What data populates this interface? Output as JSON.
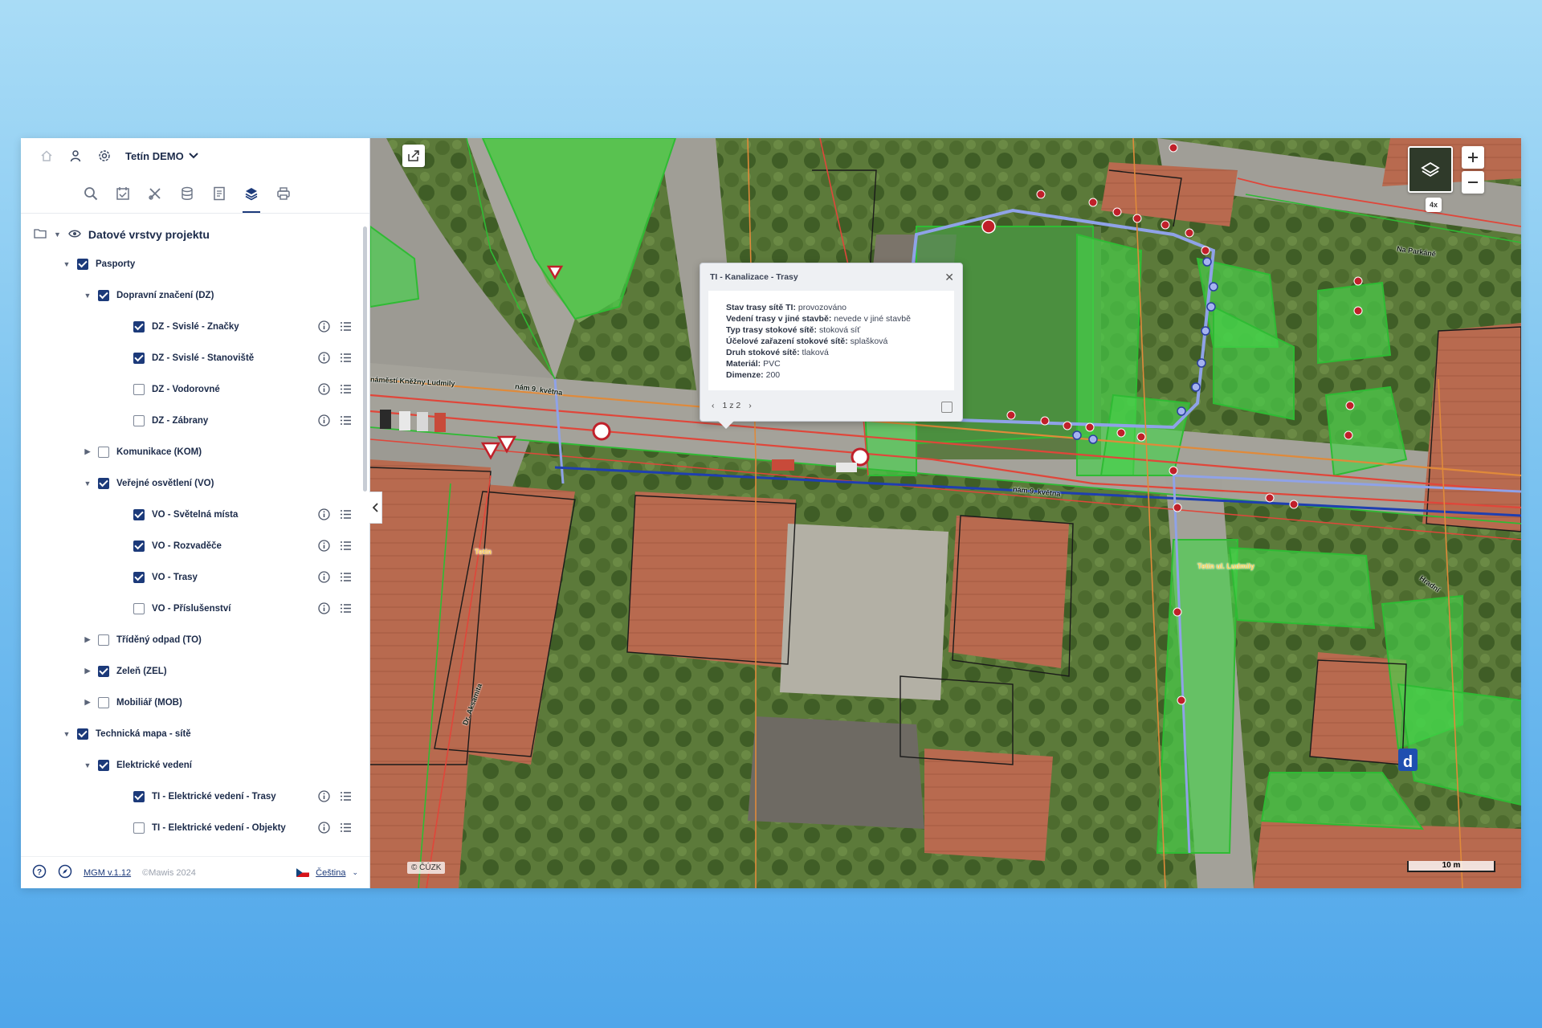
{
  "header": {
    "project_name": "Tetín DEMO",
    "home_icon": "home-icon",
    "user_icon": "user-icon",
    "project_icon": "settings-icon"
  },
  "toolbar": {
    "tools": [
      "search-icon",
      "measure-icon",
      "edit-tools-icon",
      "database-icon",
      "bookmark-icon",
      "layers-icon",
      "print-icon"
    ],
    "active": "layers-icon"
  },
  "tree": {
    "root_label": "Datové vrstvy projektu",
    "items": [
      {
        "label": "Pasporty",
        "level": 0,
        "expanded": true,
        "checked": true,
        "twisty": true,
        "actions": false
      },
      {
        "label": "Dopravní značení (DZ)",
        "level": 1,
        "expanded": true,
        "checked": true,
        "twisty": true,
        "actions": false
      },
      {
        "label": "DZ - Svislé - Značky",
        "level": 2,
        "checked": true,
        "twisty": false,
        "actions": true
      },
      {
        "label": "DZ - Svislé - Stanoviště",
        "level": 2,
        "checked": true,
        "twisty": false,
        "actions": true
      },
      {
        "label": "DZ - Vodorovné",
        "level": 2,
        "checked": false,
        "twisty": false,
        "actions": true
      },
      {
        "label": "DZ - Zábrany",
        "level": 2,
        "checked": false,
        "twisty": false,
        "actions": true
      },
      {
        "label": "Komunikace (KOM)",
        "level": 1,
        "expanded": false,
        "checked": false,
        "twisty": true,
        "actions": false
      },
      {
        "label": "Veřejné osvětlení (VO)",
        "level": 1,
        "expanded": true,
        "checked": true,
        "twisty": true,
        "actions": false
      },
      {
        "label": "VO - Světelná místa",
        "level": 2,
        "checked": true,
        "twisty": false,
        "actions": true
      },
      {
        "label": "VO - Rozvaděče",
        "level": 2,
        "checked": true,
        "twisty": false,
        "actions": true
      },
      {
        "label": "VO - Trasy",
        "level": 2,
        "checked": true,
        "twisty": false,
        "actions": true
      },
      {
        "label": "VO - Příslušenství",
        "level": 2,
        "checked": false,
        "twisty": false,
        "actions": true
      },
      {
        "label": "Tříděný odpad (TO)",
        "level": 1,
        "expanded": false,
        "checked": false,
        "twisty": true,
        "actions": false
      },
      {
        "label": "Zeleň (ZEL)",
        "level": 1,
        "expanded": false,
        "checked": true,
        "twisty": true,
        "actions": false
      },
      {
        "label": "Mobiliář (MOB)",
        "level": 1,
        "expanded": false,
        "checked": false,
        "twisty": true,
        "actions": false
      },
      {
        "label": "Technická mapa - sítě",
        "level": 0,
        "expanded": true,
        "checked": true,
        "twisty": true,
        "actions": false
      },
      {
        "label": "Elektrické vedení",
        "level": 1,
        "expanded": true,
        "checked": true,
        "twisty": true,
        "actions": false
      },
      {
        "label": "TI - Elektrické vedení - Trasy",
        "level": 2,
        "checked": true,
        "twisty": false,
        "actions": true
      },
      {
        "label": "TI - Elektrické vedení - Objekty",
        "level": 2,
        "checked": false,
        "twisty": false,
        "actions": true
      }
    ]
  },
  "footer": {
    "version": "MGM v.1.12",
    "copyright": "©Mawis 2024",
    "language": "Čeština"
  },
  "popup": {
    "title": "TI - Kanalizace - Trasy",
    "rows": [
      {
        "key": "Stav trasy sítě TI:",
        "value": "provozováno"
      },
      {
        "key": "Vedení trasy v jiné stavbě:",
        "value": "nevede v jiné stavbě"
      },
      {
        "key": "Typ trasy stokové sítě:",
        "value": "stoková síť"
      },
      {
        "key": "Účelové zařazení stokové sítě:",
        "value": "splašková"
      },
      {
        "key": "Druh stokové sítě:",
        "value": "tlaková"
      },
      {
        "key": "Materiál:",
        "value": "PVC"
      },
      {
        "key": "Dimenze:",
        "value": "200"
      }
    ],
    "pager": "1 z 2"
  },
  "map": {
    "attribution": "© ČÚZK",
    "scale_label": "10 m",
    "layer_badge": "4x",
    "street_labels": [
      "náměstí Kněžny Ludmily",
      "nám 9. května",
      "nám 9. května",
      "Na Parkáně",
      "Hradní",
      "Dr. Aksamita"
    ],
    "place_labels": [
      "Tetín",
      "Tetín ul. Ludmily"
    ],
    "colors": {
      "sewer": "#8fa2e8",
      "power": "#e0463a",
      "water": "#e08a3a",
      "green": "#45d24a",
      "parcel": "#1a1a1a"
    }
  }
}
